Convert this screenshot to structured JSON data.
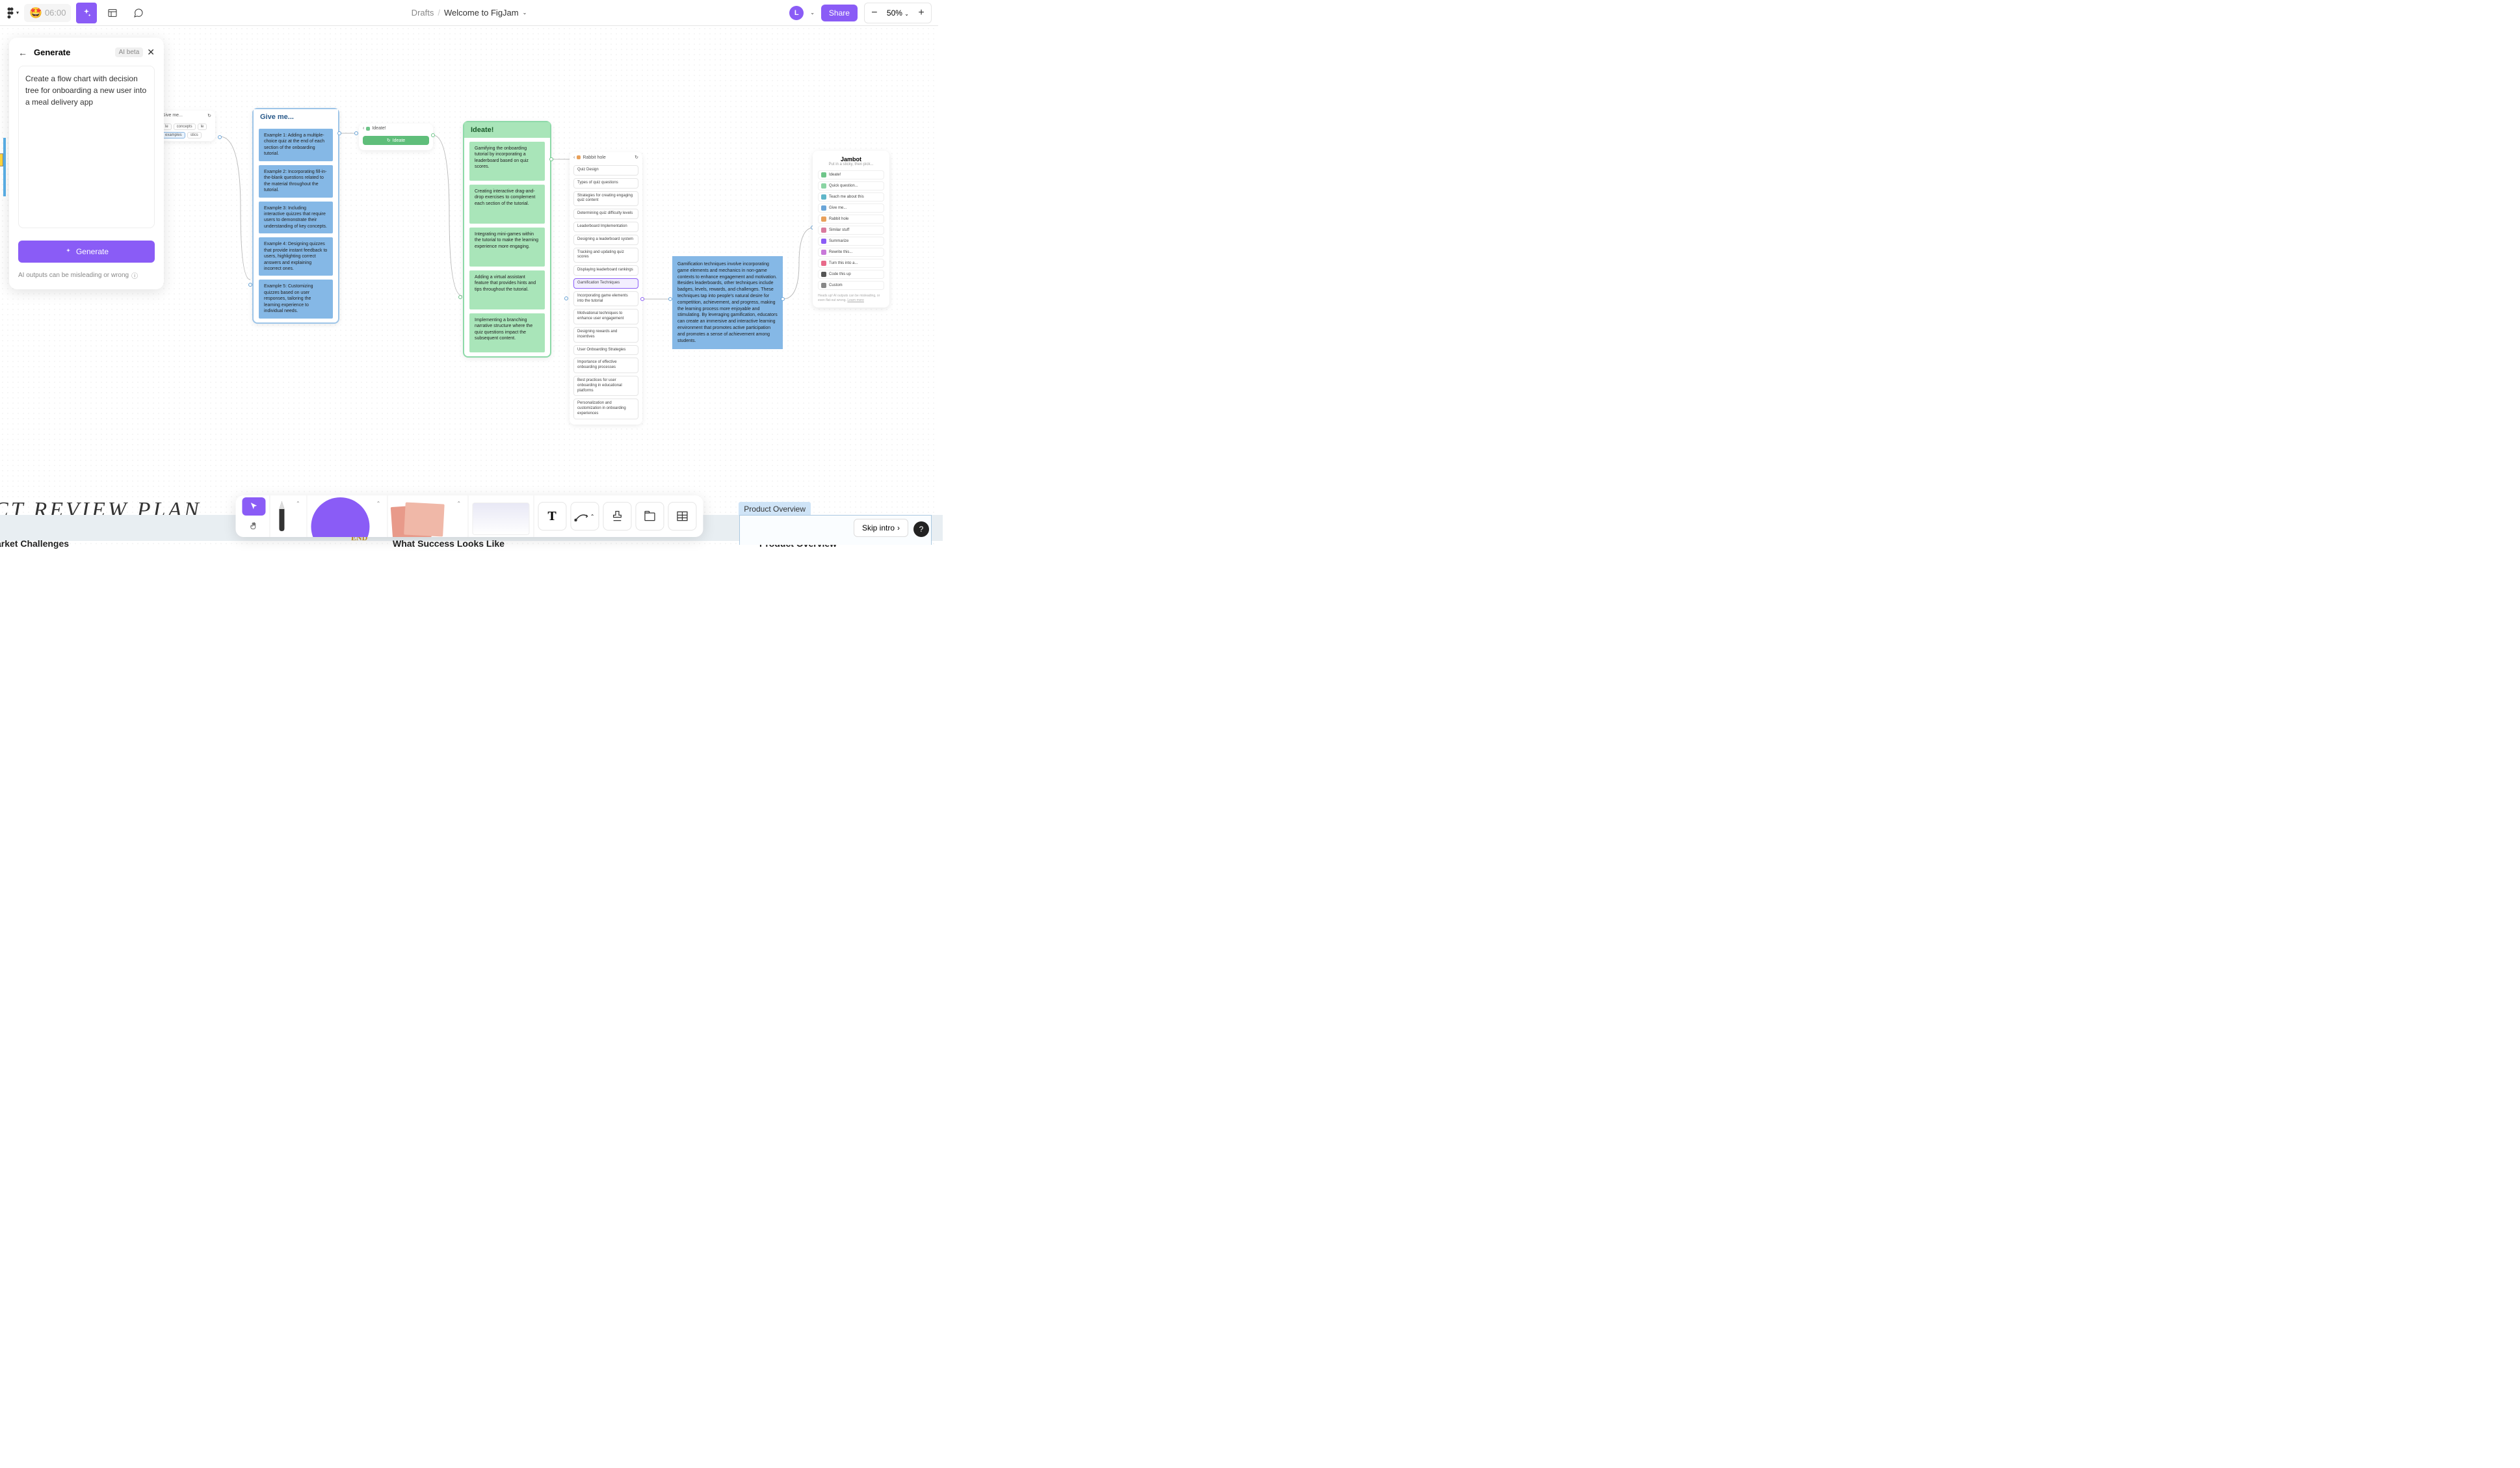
{
  "toolbar": {
    "timer": "06:00",
    "breadcrumb_drafts": "Drafts",
    "breadcrumb_title": "Welcome to FigJam",
    "avatar_initial": "L",
    "share": "Share",
    "zoom": "50%"
  },
  "generate_panel": {
    "title": "Generate",
    "badge": "AI beta",
    "prompt": "Create a flow chart with decision tree for onboarding a new user into a meal delivery app",
    "button": "Generate",
    "footer": "AI outputs can be misleading or wrong"
  },
  "giveme_small": {
    "title": "Give me...",
    "chips": [
      "le",
      "concepts",
      "le",
      "examples",
      "stics"
    ]
  },
  "giveme_card": {
    "title": "Give me...",
    "items": [
      "Example 1: Adding a multiple-choice quiz at the end of each section of the onboarding tutorial.",
      "Example 2: Incorporating fill-in-the-blank questions related to the material throughout the tutorial.",
      "Example 3: Including interactive quizzes that require users to demonstrate their understanding of key concepts.",
      "Example 4: Designing quizzes that provide instant feedback to users, highlighting correct answers and explaining incorrect ones.",
      "Example 5: Customizing quizzes based on user responses, tailoring the learning experience to individual needs."
    ]
  },
  "mini_ideate": {
    "header": "Ideate!",
    "button": "Ideate"
  },
  "ideate_card": {
    "title": "Ideate!",
    "items": [
      "Gamifying the onboarding tutorial by incorporating a leaderboard based on quiz scores.",
      "Creating interactive drag-and-drop exercises to complement each section of the tutorial.",
      "Integrating mini-games within the tutorial to make the learning experience more engaging.",
      "Adding a virtual assistant feature that provides hints and tips throughout the tutorial.",
      "Implementing a branching narrative structure where the quiz questions impact the subsequent content."
    ]
  },
  "rabbit_card": {
    "title": "Rabbit hole",
    "items": [
      "Quiz Design",
      "Types of quiz questions",
      "Strategies for creating engaging quiz content",
      "Determining quiz difficulty levels",
      "Leaderboard Implementation",
      "Designing a leaderboard system",
      "Tracking and updating quiz scores",
      "Displaying leaderboard rankings",
      "Gamification Techniques",
      "Incorporating game elements into the tutorial",
      "Motivational techniques to enhance user engagement",
      "Designing rewards and incentives",
      "User Onboarding Strategies",
      "Importance of effective onboarding processes",
      "Best practices for user onboarding in educational platforms",
      "Personalization and customization in onboarding experiences"
    ],
    "active_index": 8
  },
  "blue_note": "Gamification techniques involve incorporating game elements and mechanics in non-game contexts to enhance engagement and motivation. Besides leaderboards, other techniques include badges, levels, rewards, and challenges. These techniques tap into people's natural desire for competition, achievement, and progress, making the learning process more enjoyable and stimulating. By leveraging gamification, educators can create an immersive and interactive learning environment that promotes active participation and promotes a sense of achievement among students.",
  "jambot": {
    "title": "Jambot",
    "subtitle": "Put in a sticky, then pick...",
    "items": [
      {
        "label": "Ideate!",
        "color": "#6ec589"
      },
      {
        "label": "Quick question...",
        "color": "#8ad4a3"
      },
      {
        "label": "Teach me about this",
        "color": "#5fb6c9"
      },
      {
        "label": "Give me...",
        "color": "#6aa5d8"
      },
      {
        "label": "Rabbit hole",
        "color": "#e8a05a"
      },
      {
        "label": "Similar stuff",
        "color": "#d97a9e"
      },
      {
        "label": "Summarize",
        "color": "#8a5cf6"
      },
      {
        "label": "Rewrite this...",
        "color": "#c878d9"
      },
      {
        "label": "Turn this into a...",
        "color": "#e86a8a"
      },
      {
        "label": "Code this up",
        "color": "#555"
      },
      {
        "label": "Custom",
        "color": "#888"
      }
    ],
    "footer_text": "Heads up! AI outputs can be misleading, or even flat-out wrong. ",
    "footer_link": "Learn more"
  },
  "bottom": {
    "review_title": "CT REVIEW PLAN",
    "label_market": "arket Challenges",
    "label_success": "What Success Looks Like",
    "label_overview1": "Product Overview",
    "label_overview2": "Product Overview",
    "skip": "Skip intro"
  }
}
